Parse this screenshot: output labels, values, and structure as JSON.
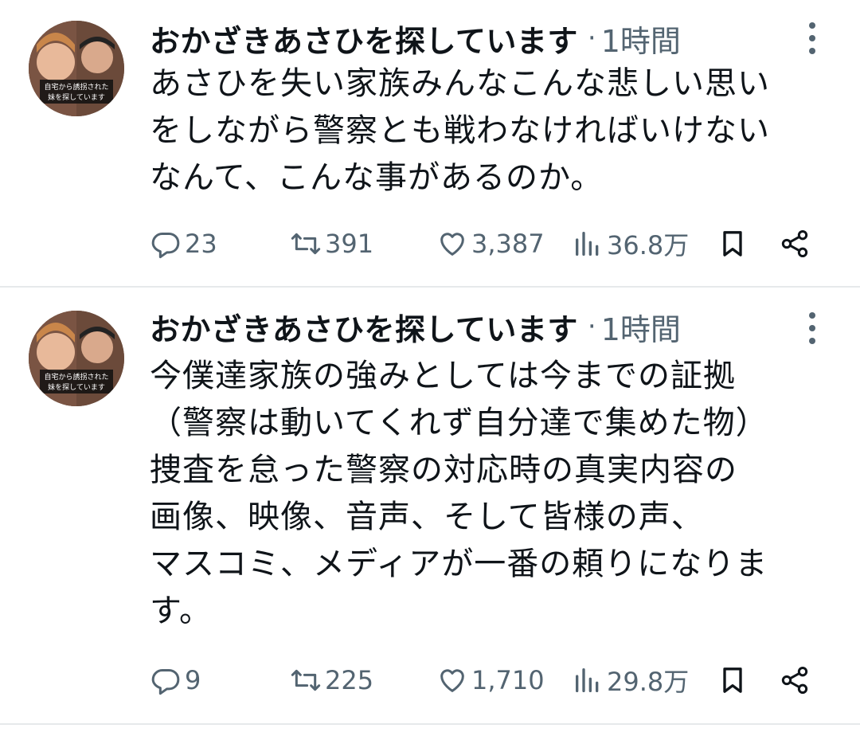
{
  "tweets": [
    {
      "author": "おかざきあさひを探しています",
      "separator": "·",
      "time": "1時間",
      "avatar_caption_1": "自宅から誘拐された",
      "avatar_caption_2": "妹を探しています",
      "text": "あさひを失い家族みんなこんな悲しい思い\nをしながら警察とも戦わなければいけない\nなんて、こんな事があるのか。",
      "replies": "23",
      "retweets": "391",
      "likes": "3,387",
      "views": "36.8万"
    },
    {
      "author": "おかざきあさひを探しています",
      "separator": "·",
      "time": "1時間",
      "avatar_caption_1": "自宅から誘拐された",
      "avatar_caption_2": "妹を探しています",
      "text": "今僕達家族の強みとしては今までの証拠\n（警察は動いてくれず自分達で集めた物）\n捜査を怠った警察の対応時の真実内容の\n画像、映像、音声、そして皆様の声、\nマスコミ、メディアが一番の頼りになりま\nす。",
      "replies": "9",
      "retweets": "225",
      "likes": "1,710",
      "views": "29.8万"
    }
  ],
  "icons": {
    "reply": "reply-icon",
    "retweet": "retweet-icon",
    "like": "heart-icon",
    "views": "views-icon",
    "bookmark": "bookmark-icon",
    "share": "share-icon",
    "more": "more-vertical-icon"
  },
  "colors": {
    "text": "#0f1419",
    "secondary": "#536471",
    "divider": "#e6e9eb"
  }
}
